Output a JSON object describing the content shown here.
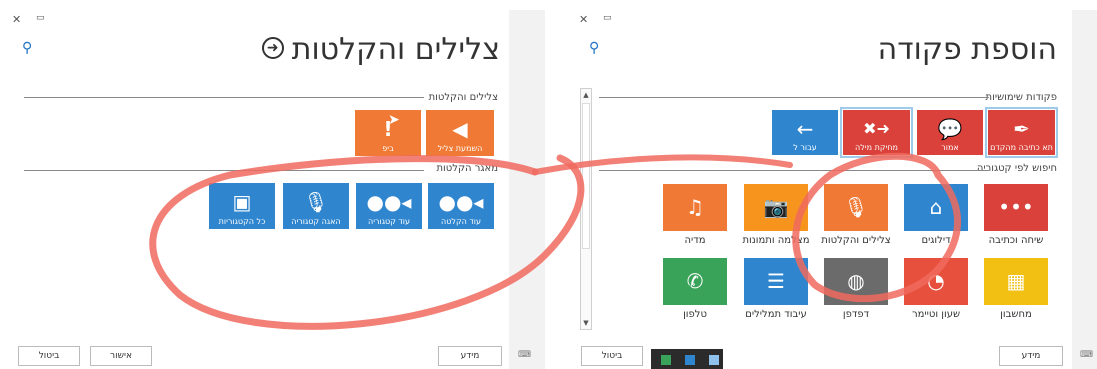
{
  "left": {
    "title": "צלילים והקלטות",
    "section1": "צלילים והקלטות",
    "section2": "מאגר הקלטות",
    "tiles_top": [
      {
        "label": "השמעת צליל",
        "icon": "play-left-icon",
        "color": "#f07a35"
      },
      {
        "label": "ביפ",
        "icon": "exclamation-icon",
        "color": "#f07a35"
      }
    ],
    "tiles_bottom": [
      {
        "label": "עוד הקלטה",
        "icon": "record-icon",
        "color": "#2f86cf"
      },
      {
        "label": "עוד קטגוריה",
        "icon": "record-icon",
        "color": "#2f86cf"
      },
      {
        "label": "האגה קטגוריה",
        "icon": "microphone-icon",
        "color": "#2f86cf"
      },
      {
        "label": "כל הקטגוריות",
        "icon": "phone-mic-icon",
        "color": "#2f86cf"
      }
    ],
    "buttons": {
      "cancel": "ביטול",
      "confirm": "אישור",
      "info": "מידע"
    }
  },
  "right": {
    "title": "הוספת פקודה",
    "section1": "פקודות שימושיות",
    "section2": "חיפוש לפי קטגוריה",
    "useful": [
      {
        "label": "תא כתיבה מהקדם",
        "icon": "feather-icon",
        "color": "#d9413a"
      },
      {
        "label": "אמור",
        "icon": "speech-bubble-icon",
        "color": "#d9413a"
      },
      {
        "label": "מחיקת מילה",
        "icon": "delete-word-icon",
        "color": "#d9413a"
      },
      {
        "label": "עבור ל",
        "icon": "arrow-left-icon",
        "color": "#2f86cf"
      }
    ],
    "categories_row1": [
      {
        "label": "שיחה וכתיבה",
        "icon": "dots-icon",
        "color": "#d9413a"
      },
      {
        "label": "דילוגים",
        "icon": "home-icon",
        "color": "#2f86cf"
      },
      {
        "label": "צלילים והקלטות",
        "icon": "microphone-icon",
        "color": "#f07a35"
      },
      {
        "label": "מצלמה ותמונות",
        "icon": "camera-icon",
        "color": "#f7941e"
      },
      {
        "label": "מדיה",
        "icon": "music-note-icon",
        "color": "#f07a35"
      }
    ],
    "categories_row2": [
      {
        "label": "מחשבון",
        "icon": "calculator-icon",
        "color": "#f2c012"
      },
      {
        "label": "שעון וטיימר",
        "icon": "clock-icon",
        "color": "#e8503e"
      },
      {
        "label": "דפדפן",
        "icon": "globe-icon",
        "color": "#6b6b6b"
      },
      {
        "label": "עיבוד תמלילים",
        "icon": "text-lines-icon",
        "color": "#2f86cf"
      },
      {
        "label": "טלפון",
        "icon": "phone-icon",
        "color": "#3aa35a"
      }
    ],
    "buttons": {
      "cancel": "ביטול",
      "info": "מידע"
    }
  },
  "annotation_color": "#f06a5e"
}
